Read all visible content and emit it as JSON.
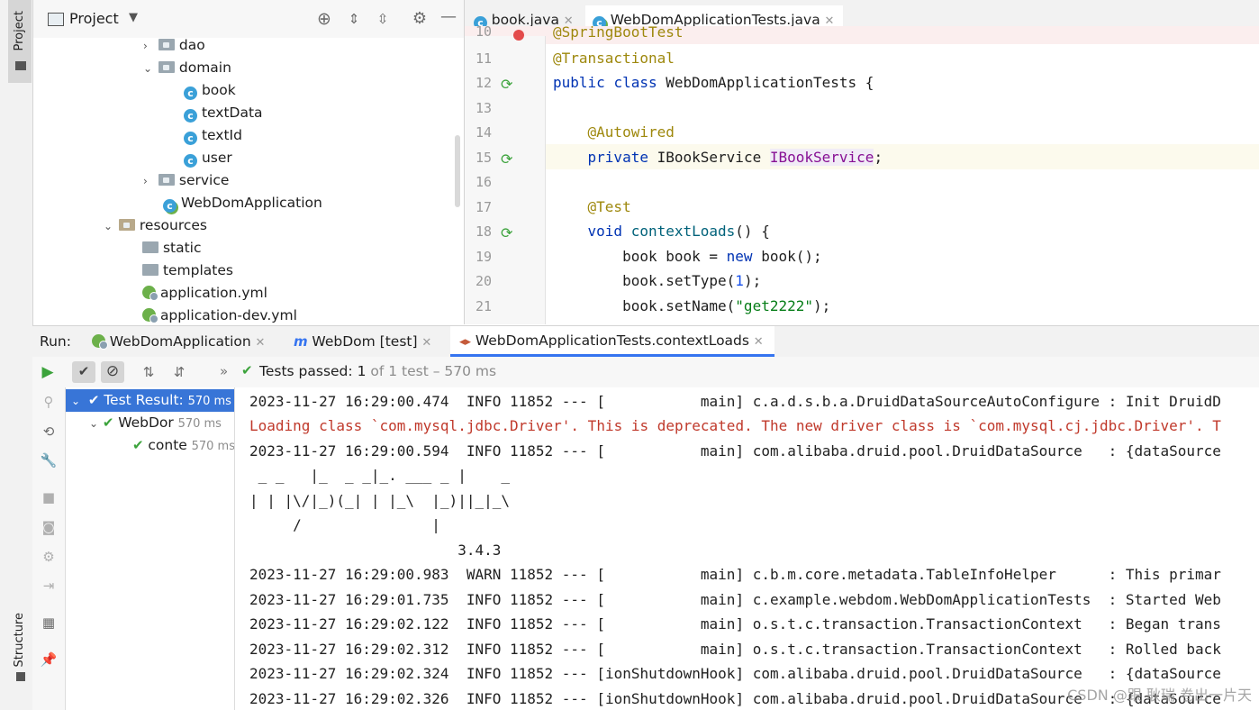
{
  "left_strip": {
    "project_tab": "Project",
    "structure_tab": "Structure"
  },
  "project_panel": {
    "title": "Project",
    "tree": [
      {
        "label": "dao",
        "type": "package",
        "expanded": false
      },
      {
        "label": "domain",
        "type": "package",
        "expanded": true
      },
      {
        "label": "book",
        "type": "class"
      },
      {
        "label": "textData",
        "type": "class"
      },
      {
        "label": "textId",
        "type": "class"
      },
      {
        "label": "user",
        "type": "class"
      },
      {
        "label": "service",
        "type": "package",
        "expanded": false
      },
      {
        "label": "WebDomApplication",
        "type": "spring-class"
      },
      {
        "label": "resources",
        "type": "resources",
        "expanded": true
      },
      {
        "label": "static",
        "type": "folder"
      },
      {
        "label": "templates",
        "type": "folder"
      },
      {
        "label": "application.yml",
        "type": "yml"
      },
      {
        "label": "application-dev.yml",
        "type": "yml"
      }
    ]
  },
  "editor": {
    "tabs": [
      {
        "label": "book.java",
        "active": false
      },
      {
        "label": "WebDomApplicationTests.java",
        "active": true
      }
    ],
    "line_numbers": [
      "10",
      "11",
      "12",
      "13",
      "14",
      "15",
      "16",
      "17",
      "18",
      "19",
      "20",
      "21"
    ],
    "top_partial": "@SpringBootTest",
    "code": {
      "l11": "@Transactional",
      "l12_kw1": "public",
      "l12_kw2": "class",
      "l12_rest": "WebDomApplicationTests {",
      "l14": "@Autowired",
      "l15_kw": "private",
      "l15_type": "IBookService",
      "l15_field": "IBookService",
      "l15_end": ";",
      "l17": "@Test",
      "l18_kw": "void",
      "l18_fn": "contextLoads",
      "l18_rest": "() {",
      "l19_a": "book book = ",
      "l19_kw": "new",
      "l19_b": " book();",
      "l20_a": "book.setType(",
      "l20_num": "1",
      "l20_b": ");",
      "l21_a": "book.setName(",
      "l21_str": "\"get2222\"",
      "l21_b": ");"
    }
  },
  "run_panel": {
    "label": "Run:",
    "tabs": [
      {
        "label": "WebDomApplication"
      },
      {
        "label": "WebDom [test]"
      },
      {
        "label": "WebDomApplicationTests.contextLoads",
        "active": true
      }
    ],
    "status_prefix": "Tests passed:",
    "status_count": "1",
    "status_suffix": "of 1 test – 570 ms",
    "tests": [
      {
        "label": "Test Result:",
        "time": "570 ms",
        "selected": true
      },
      {
        "label": "WebDor",
        "time": "570 ms"
      },
      {
        "label": "conte",
        "time": "570 ms"
      }
    ],
    "console": [
      {
        "text": "2023-11-27 16:29:00.474  INFO 11852 --- [           main] c.a.d.s.b.a.DruidDataSourceAutoConfigure : Init DruidD",
        "kind": "info"
      },
      {
        "text": "Loading class `com.mysql.jdbc.Driver'. This is deprecated. The new driver class is `com.mysql.cj.jdbc.Driver'. T",
        "kind": "warn"
      },
      {
        "text": "2023-11-27 16:29:00.594  INFO 11852 --- [           main] com.alibaba.druid.pool.DruidDataSource   : {dataSource",
        "kind": "info"
      },
      {
        "text": " _ _   |_  _ _|_. ___ _ |    _ ",
        "kind": "banner"
      },
      {
        "text": "| | |\\/|_)(_| | |_\\  |_)||_|_\\ ",
        "kind": "banner"
      },
      {
        "text": "     /               |",
        "kind": "banner"
      },
      {
        "text": "                        3.4.3 ",
        "kind": "banner"
      },
      {
        "text": "2023-11-27 16:29:00.983  WARN 11852 --- [           main] c.b.m.core.metadata.TableInfoHelper      : This primar",
        "kind": "info"
      },
      {
        "text": "2023-11-27 16:29:01.735  INFO 11852 --- [           main] c.example.webdom.WebDomApplicationTests  : Started Web",
        "kind": "info"
      },
      {
        "text": "2023-11-27 16:29:02.122  INFO 11852 --- [           main] o.s.t.c.transaction.TransactionContext   : Began trans",
        "kind": "info"
      },
      {
        "text": "2023-11-27 16:29:02.312  INFO 11852 --- [           main] o.s.t.c.transaction.TransactionContext   : Rolled back",
        "kind": "info"
      },
      {
        "text": "2023-11-27 16:29:02.324  INFO 11852 --- [ionShutdownHook] com.alibaba.druid.pool.DruidDataSource   : {dataSource",
        "kind": "info"
      },
      {
        "text": "2023-11-27 16:29:02.326  INFO 11852 --- [ionShutdownHook] com.alibaba.druid.pool.DruidDataSource   : {dataSource",
        "kind": "info"
      }
    ],
    "watermark": "CSDN @跟 耿瑞 卷出一片天"
  },
  "colors": {
    "accent": "#3574f0",
    "selection": "#3875d7",
    "pass_green": "#3ca33c",
    "error_red": "#c0392b"
  }
}
